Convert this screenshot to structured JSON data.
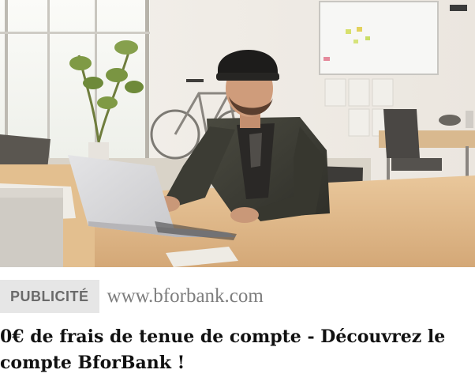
{
  "ad": {
    "image_alt": "Homme portant un bonnet noir travaillant sur un ordinateur portable dans un bureau lumineux",
    "sponsor_label": "PUBLICITÉ",
    "domain": "www.bforbank.com",
    "headline": "0€ de frais de tenue de compte - Découvrez le compte BforBank !"
  },
  "colors": {
    "badge_bg": "#e6e6e6",
    "badge_text": "#6a6a6a",
    "domain_text": "#7d7d7d",
    "headline_text": "#111111"
  }
}
